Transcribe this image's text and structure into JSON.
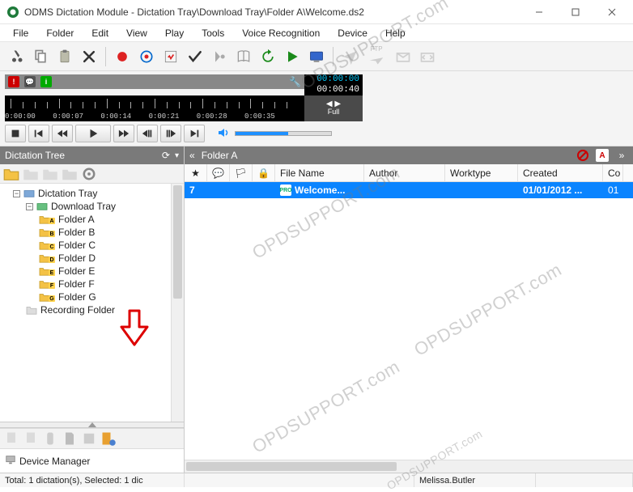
{
  "window": {
    "title": "ODMS Dictation Module - Dictation Tray\\Download Tray\\Folder A\\Welcome.ds2"
  },
  "menu": [
    "File",
    "Folder",
    "Edit",
    "View",
    "Play",
    "Tools",
    "Voice Recognition",
    "Device",
    "Help"
  ],
  "timeline": {
    "current": "00:00:00",
    "total": "00:00:40",
    "ticks": [
      "0:00:00",
      "0:00:07",
      "0:00:14",
      "0:00:21",
      "0:00:28",
      "0:00:35"
    ],
    "zoom_label": "Full"
  },
  "left_panel": {
    "title": "Dictation Tree",
    "tree": {
      "root": "Dictation Tray",
      "download": "Download Tray",
      "folders": [
        {
          "badge": "A",
          "label": "Folder A"
        },
        {
          "badge": "B",
          "label": "Folder B"
        },
        {
          "badge": "C",
          "label": "Folder C"
        },
        {
          "badge": "D",
          "label": "Folder D"
        },
        {
          "badge": "E",
          "label": "Folder E"
        },
        {
          "badge": "F",
          "label": "Folder F"
        },
        {
          "badge": "G",
          "label": "Folder G"
        }
      ],
      "recording": "Recording Folder"
    },
    "device_manager": "Device Manager"
  },
  "content": {
    "title": "Folder A",
    "columns": {
      "file": "File Name",
      "author": "Author",
      "worktype": "Worktype",
      "created": "Created",
      "co": "Co"
    },
    "rows": [
      {
        "priority": "7",
        "file": "Welcome...",
        "author": "",
        "worktype": "",
        "created": "01/01/2012 ...",
        "co": "01"
      }
    ]
  },
  "status": {
    "left": "Total: 1 dictation(s), Selected: 1 dic",
    "user": "Melissa.Butler"
  },
  "watermark": "OPDSUPPORT.com"
}
